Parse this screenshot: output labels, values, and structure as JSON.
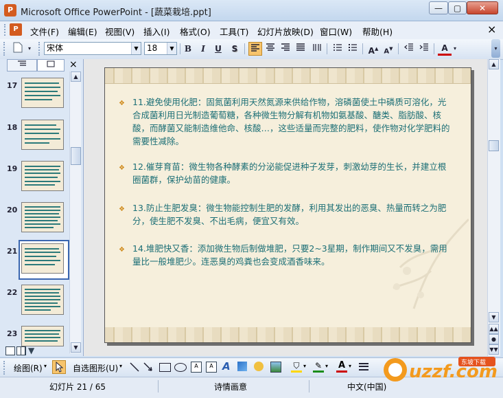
{
  "window": {
    "title": "Microsoft Office PowerPoint - [蔬菜栽培.ppt]",
    "app_icon": "powerpoint-icon",
    "controls": {
      "minimize": "—",
      "maximize": "▢",
      "close": "✕"
    }
  },
  "menu": {
    "items": [
      "文件(F)",
      "编辑(E)",
      "视图(V)",
      "插入(I)",
      "格式(O)",
      "工具(T)",
      "幻灯片放映(D)",
      "窗口(W)",
      "帮助(H)"
    ],
    "doc_close": "×"
  },
  "toolbar": {
    "font_name": "宋体",
    "font_size": "18",
    "bold": "B",
    "italic": "I",
    "underline": "U",
    "shadow": "S",
    "font_color_label": "A",
    "colors": {
      "font_color": "#cc0000",
      "active_button": "#f7c46c"
    }
  },
  "left_pane": {
    "tabs": [
      "outline-tab",
      "slides-tab"
    ],
    "close": "×",
    "slides": [
      {
        "number": "17"
      },
      {
        "number": "18"
      },
      {
        "number": "19"
      },
      {
        "number": "20"
      },
      {
        "number": "21",
        "selected": true
      },
      {
        "number": "22"
      },
      {
        "number": "23"
      }
    ]
  },
  "slide": {
    "bullets": [
      {
        "text": "11.避免使用化肥：固氮菌利用天然氮源来供给作物，溶磷菌使土中磷质可溶化，光合成菌利用日光制造葡萄糖，各种微生物分解有机物如氨基酸、醣类、脂肪酸、核酸，而酵菌又能制造维他命、核酸…，这些适量而完整的肥料，使作物对化学肥料的需要性减除。"
      },
      {
        "text": "12.催芽育苗：微生物各种酵素的分泌能促进种子发芽，刺激幼芽的生长，并建立根圈菌群，保护幼苗的健康。"
      },
      {
        "text": "13.防止生肥发臭：微生物能控制生肥的发酵，利用其发出的恶臭、热量而转之为肥分，使生肥不发臭、不出毛病，便宜又有效。"
      },
      {
        "text": "14.堆肥快又香：添加微生物后制做堆肥，只要2~3星期，制作期间又不发臭，需用量比一般堆肥少。连恶臭的鸡粪也会变成酒香味来。"
      }
    ],
    "colors": {
      "text": "#1c6f76",
      "bullet": "#cf8a1b",
      "background": "#f6efdc"
    }
  },
  "drawing_toolbar": {
    "draw": "绘图(R)",
    "autoshapes": "自选图形(U)"
  },
  "status": {
    "slide": "幻灯片 21 / 65",
    "design": "诗情画意",
    "language": "中文(中国)"
  },
  "watermark": {
    "text": "uzzf.com",
    "badge": "东坡下载"
  }
}
